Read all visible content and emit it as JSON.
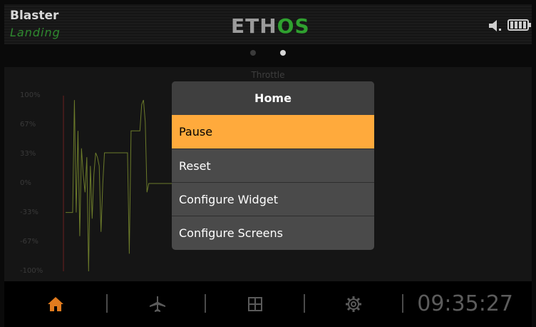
{
  "header": {
    "model_name": "Blaster",
    "flight_mode": "Landing",
    "logo_part1": "ETH",
    "logo_part2": "OS",
    "colors": {
      "mode": "#2f8a2f",
      "logo_accent": "#2fa02f"
    }
  },
  "pager": {
    "count": 2,
    "active": 2
  },
  "chart": {
    "title": "Throttle",
    "ticks": [
      "100%",
      "67%",
      "33%",
      "0%",
      "-33%",
      "-67%",
      "-100%"
    ]
  },
  "chart_data": {
    "type": "line",
    "title": "Throttle",
    "ylim": [
      -100,
      100
    ],
    "yticks": [
      "100%",
      "67%",
      "33%",
      "0%",
      "-33%",
      "-67%",
      "-100%"
    ],
    "series": [
      {
        "color": "#6b7a2a",
        "values": [
          -33,
          -33,
          -33,
          -33,
          -33,
          95,
          -33,
          60,
          -60,
          40,
          10,
          -10,
          30,
          -100,
          20,
          -40,
          10,
          35,
          30,
          20,
          -55,
          0,
          35,
          35,
          35,
          35,
          35,
          35,
          35,
          35,
          35,
          35,
          35,
          35,
          35,
          35,
          -80,
          60,
          60,
          60,
          60,
          60,
          60,
          90,
          95,
          70,
          -10,
          0,
          0,
          0,
          0,
          0,
          0,
          0,
          0,
          0,
          0,
          0,
          0,
          0,
          0
        ]
      }
    ]
  },
  "dialog": {
    "title": "Home",
    "items": [
      {
        "label": "Pause",
        "selected": true
      },
      {
        "label": "Reset",
        "selected": false
      },
      {
        "label": "Configure Widget",
        "selected": false
      },
      {
        "label": "Configure Screens",
        "selected": false
      }
    ],
    "accent_color": "#ffaa3c"
  },
  "footer": {
    "icons": [
      "home-icon",
      "airplane-icon",
      "screens-icon",
      "gear-icon"
    ],
    "time": "09:35:27"
  }
}
